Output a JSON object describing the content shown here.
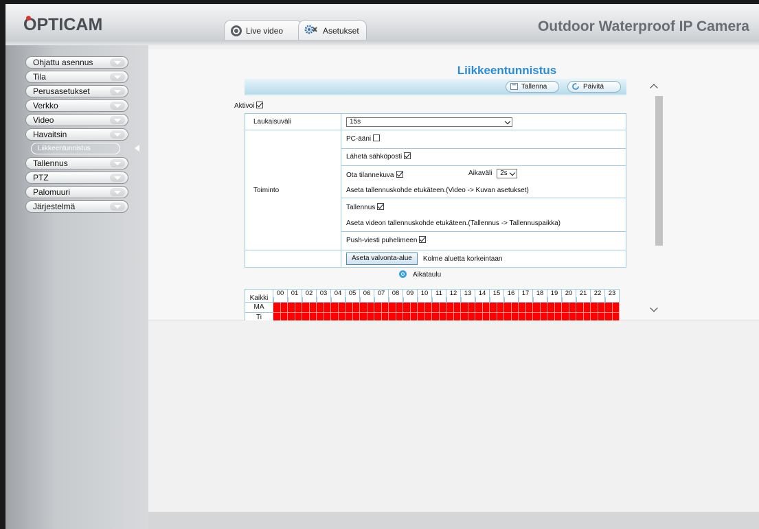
{
  "header": {
    "logo": "OPTICAM",
    "product_title": "Outdoor Waterproof IP Camera",
    "tabs": [
      {
        "label": "Live video"
      },
      {
        "label": "Asetukset"
      }
    ]
  },
  "sidebar": {
    "items": [
      {
        "label": "Ohjattu asennus"
      },
      {
        "label": "Tila"
      },
      {
        "label": "Perusasetukset"
      },
      {
        "label": "Verkko"
      },
      {
        "label": "Video"
      },
      {
        "label": "Havaitsin"
      },
      {
        "label": "Tallennus"
      },
      {
        "label": "PTZ"
      },
      {
        "label": "Palomuuri"
      },
      {
        "label": "Järjestelmä"
      }
    ],
    "active_sub": "Liikkeentunnistus"
  },
  "main": {
    "title": "Liikkeentunnistus",
    "toolbar": {
      "save_label": "Tallenna",
      "refresh_label": "Päivitä"
    },
    "activate_label": "Aktivoi",
    "activate_checked": true,
    "interval_label": "Laukaisuväli",
    "interval_value": "15s",
    "action_label": "Toiminto",
    "pc_sound_label": "PC-ääni",
    "email_label": "Lähetä sähköposti",
    "snapshot_label": "Ota tilannekuva",
    "snapshot_interval_label": "Aikaväli",
    "snapshot_interval_value": "2s",
    "snapshot_hint": "Aseta tallennuskohde etukäteen.(Video -> Kuvan asetukset)",
    "record_label": "Tallennus",
    "record_hint": "Aseta videon tallennuskohde etukäteen.(Tallennus -> Tallennuspaikka)",
    "push_label": "Push-viesti puhelimeen",
    "area_button": "Aseta valvonta-alue",
    "area_hint": "Kolme aluetta korkeintaan",
    "schedule_label": "Aikataulu",
    "schedule": {
      "all_label": "Kaikki",
      "hours": [
        "00",
        "01",
        "02",
        "03",
        "04",
        "05",
        "06",
        "07",
        "08",
        "09",
        "10",
        "11",
        "12",
        "13",
        "14",
        "15",
        "16",
        "17",
        "18",
        "19",
        "20",
        "21",
        "22",
        "23"
      ],
      "days": [
        "MA",
        "Ti"
      ],
      "active_color": "#ff0000"
    }
  },
  "colors": {
    "accent": "#2b8bd4",
    "border": "#9bc9e0",
    "schedule_on": "#ff0000"
  }
}
